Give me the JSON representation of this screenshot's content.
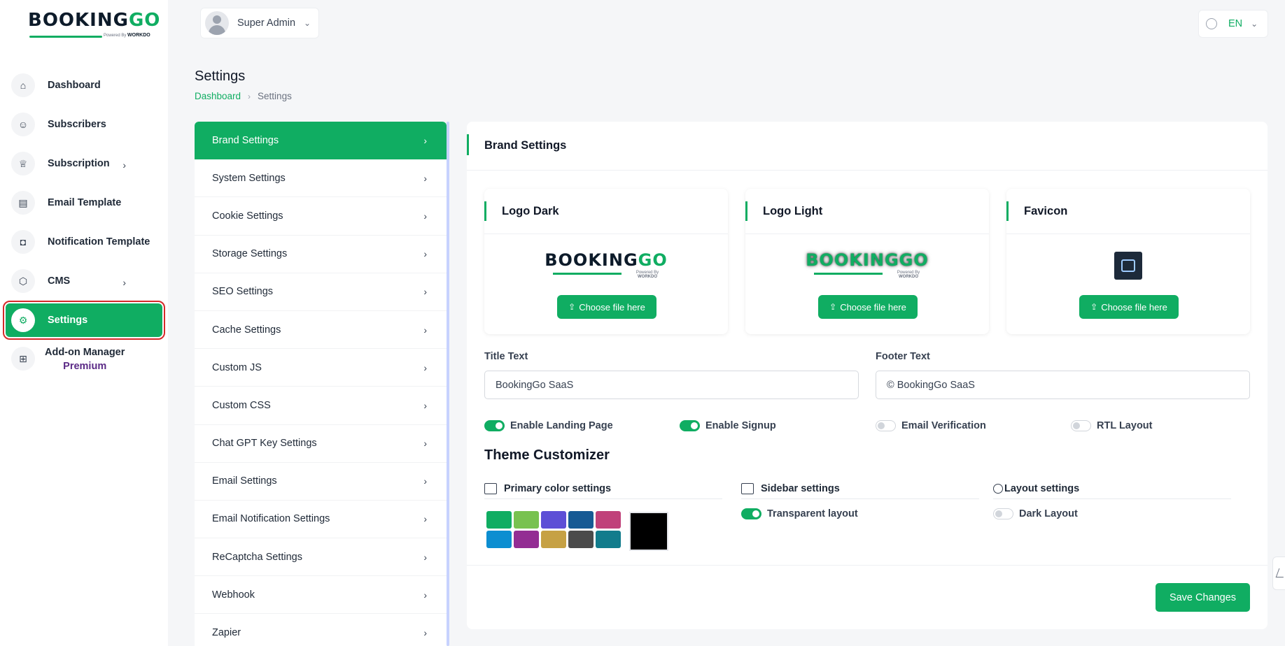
{
  "brand": {
    "logo_main": "BOOKING",
    "logo_accent": "GO",
    "powered_by": "Powered By",
    "powered_brand": "WORKDO"
  },
  "sidebar": {
    "items": [
      {
        "label": "Dashboard",
        "icon": "home-icon"
      },
      {
        "label": "Subscribers",
        "icon": "users-icon"
      },
      {
        "label": "Subscription",
        "icon": "trophy-icon",
        "has_submenu": true
      },
      {
        "label": "Email Template",
        "icon": "template-icon"
      },
      {
        "label": "Notification Template",
        "icon": "notification-icon"
      },
      {
        "label": "CMS",
        "icon": "box-icon",
        "has_submenu": true
      },
      {
        "label": "Settings",
        "icon": "gear-icon",
        "active": true
      }
    ],
    "addon": {
      "label": "Add-on Manager",
      "badge": "Premium",
      "icon": "apps-icon"
    }
  },
  "topbar": {
    "user_name": "Super Admin",
    "language": "EN"
  },
  "header": {
    "title": "Settings",
    "breadcrumb": [
      "Dashboard",
      "Settings"
    ]
  },
  "settings_menu": [
    "Brand Settings",
    "System Settings",
    "Cookie Settings",
    "Storage Settings",
    "SEO Settings",
    "Cache Settings",
    "Custom JS",
    "Custom CSS",
    "Chat GPT Key Settings",
    "Email Settings",
    "Email Notification Settings",
    "ReCaptcha Settings",
    "Webhook",
    "Zapier"
  ],
  "brand_settings": {
    "title": "Brand Settings",
    "logo_cards": [
      {
        "title": "Logo Dark",
        "button": "Choose file here"
      },
      {
        "title": "Logo Light",
        "button": "Choose file here"
      },
      {
        "title": "Favicon",
        "button": "Choose file here"
      }
    ],
    "title_text": {
      "label": "Title Text",
      "value": "BookingGo SaaS"
    },
    "footer_text": {
      "label": "Footer Text",
      "value": "© BookingGo SaaS"
    },
    "toggles": [
      {
        "label": "Enable Landing Page",
        "on": true
      },
      {
        "label": "Enable Signup",
        "on": true
      },
      {
        "label": "Email Verification",
        "on": false
      },
      {
        "label": "RTL Layout",
        "on": false
      }
    ],
    "theme": {
      "title": "Theme Customizer",
      "primary_color": {
        "label": "Primary color settings",
        "swatches": [
          "#10ad62",
          "#78c250",
          "#5d4fd6",
          "#165a94",
          "#c0417a",
          "#0c8ed1",
          "#932d93",
          "#c6a144",
          "#4b4b4b",
          "#127c8c"
        ],
        "custom": "#000000"
      },
      "sidebar": {
        "label": "Sidebar settings",
        "option": "Transparent layout",
        "on": true
      },
      "layout": {
        "label": "Layout settings",
        "option": "Dark Layout",
        "on": false
      }
    },
    "save_label": "Save Changes"
  }
}
